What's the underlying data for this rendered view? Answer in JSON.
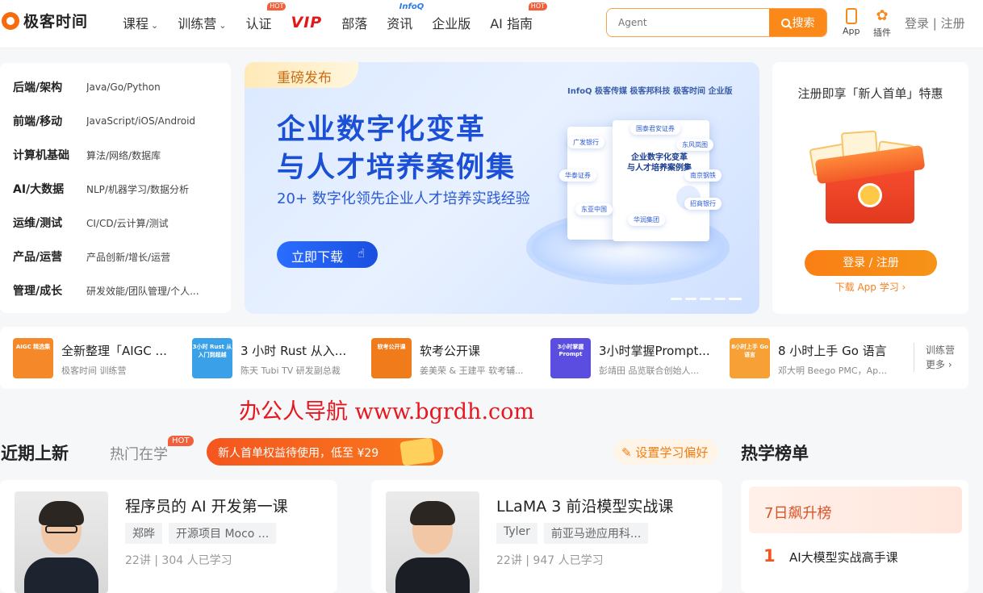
{
  "header": {
    "logo": "极客时间",
    "nav": [
      {
        "label": "课程",
        "caret": "⌄"
      },
      {
        "label": "训练营",
        "caret": "⌄"
      },
      {
        "label": "认证",
        "badge": "HOT"
      },
      {
        "label": "VIP"
      },
      {
        "label": "部落"
      },
      {
        "label": "资讯",
        "badge": "InfoQ"
      },
      {
        "label": "企业版"
      },
      {
        "label": "AI 指南",
        "badge": "HOT"
      }
    ],
    "search_placeholder": "Agent",
    "search_button": "搜索",
    "app_label": "App",
    "plugin_label": "插件",
    "login": "登录 | 注册"
  },
  "categories": [
    {
      "title": "后端/架构",
      "sub": "Java/Go/Python"
    },
    {
      "title": "前端/移动",
      "sub": "JavaScript/iOS/Android"
    },
    {
      "title": "计算机基础",
      "sub": "算法/网络/数据库"
    },
    {
      "title": "AI/大数据",
      "sub": "NLP/机器学习/数据分析"
    },
    {
      "title": "运维/测试",
      "sub": "CI/CD/云计算/测试"
    },
    {
      "title": "产品/运营",
      "sub": "产品创新/增长/运营"
    },
    {
      "title": "管理/成长",
      "sub": "研发效能/团队管理/个人..."
    }
  ],
  "banner": {
    "tag": "重磅发布",
    "logos": "InfoQ 极客传媒   极客邦科技   极客时间 企业版",
    "title1": "企业数字化变革",
    "title2": "与人才培养案例集",
    "subtitle": "20+ 数字化领先企业人才培养实践经验",
    "button": "立即下载",
    "book_title": "企业数字化变革\n与人才培养案例集",
    "chips": [
      "广发银行",
      "国泰君安证券",
      "东风岚图",
      "华泰证券",
      "南京钢铁",
      "东亚中国",
      "华润集团",
      "招商银行"
    ]
  },
  "promo": {
    "title": "注册即享「新人首单」特惠",
    "button": "登录 / 注册",
    "link": "下载 App 学习 ›"
  },
  "camps": [
    {
      "thumb": "AIGC 精选集",
      "title": "全新整理「AIGC ...",
      "sub": "极客时间 训练营",
      "color": "#f5892a"
    },
    {
      "thumb": "3小时 Rust 从入门到超越",
      "title": "3 小时 Rust 从入...",
      "sub": "陈天 Tubi TV 研发副总裁",
      "color": "#3aa1e8"
    },
    {
      "thumb": "软考公开课",
      "title": "软考公开课",
      "sub": "姜美荣 & 王建平 软考辅...",
      "color": "#f07b1b"
    },
    {
      "thumb": "3小时掌握 Prompt",
      "title": "3小时掌握Prompt...",
      "sub": "彭靖田 品览联合创始人...",
      "color": "#5a4de0"
    },
    {
      "thumb": "8小时上手 Go 语言",
      "title": "8 小时上手 Go 语言",
      "sub": "邓大明 Beego PMC，Apa...",
      "color": "#f7a035"
    }
  ],
  "camp_more": {
    "label": "训练营",
    "more": "更多 ›"
  },
  "watermark": "办公人导航  www.bgrdh.com",
  "section": {
    "title": "近期上新",
    "tab": "热门在学",
    "tab_badge": "HOT",
    "pill": "新人首单权益待使用，低至 ¥29",
    "pref": "设置学习偏好",
    "rank_title": "热学榜单"
  },
  "courses": [
    {
      "title": "程序员的 AI 开发第一课",
      "tags": [
        "郑晔",
        "开源项目 Moco ..."
      ],
      "meta": "22讲 | 304 人已学习"
    },
    {
      "title": "LLaMA 3 前沿模型实战课",
      "tags": [
        "Tyler",
        "前亚马逊应用科..."
      ],
      "meta": "22讲 | 947 人已学习"
    }
  ],
  "rank": {
    "head": "7日飙升榜",
    "num": "1",
    "item": "AI大模型实战高手课"
  }
}
